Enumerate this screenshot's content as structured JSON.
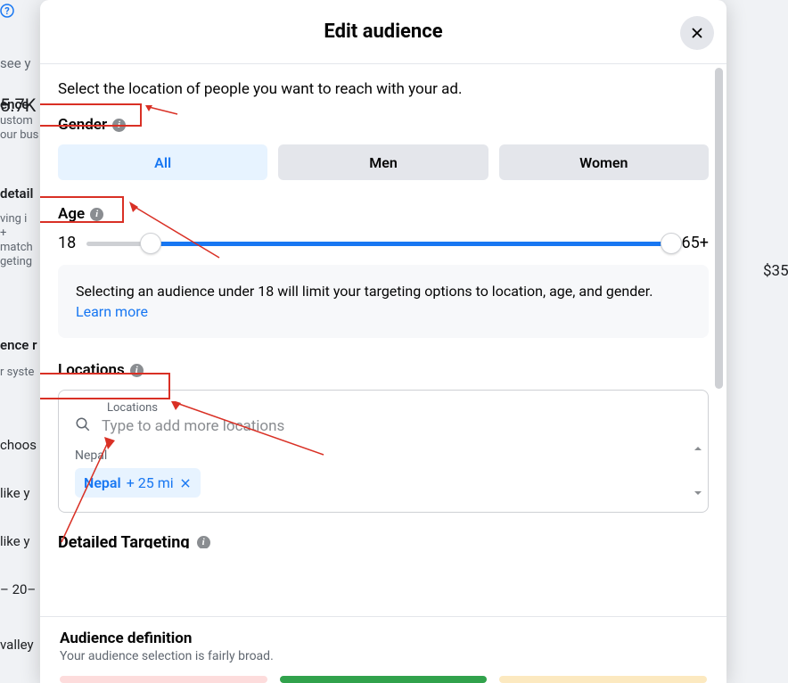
{
  "background": {
    "see": "see y",
    "ence": "ence",
    "custom": "ustom",
    "bus": "our bus",
    "detail": "detail",
    "ving": "ving i",
    "plus": "+",
    "match": "match",
    "geting": "geting",
    "ence_r": "ence r",
    "syst": "r syste",
    "choos": "choos",
    "like1": "like y",
    "like2": "like y",
    "twenty": "– 20–",
    "valley": "valley",
    "reach": "5.7K –",
    "price": "$35"
  },
  "modal": {
    "title": "Edit audience",
    "intro": "Select the location of people you want to reach with your ad.",
    "gender": {
      "label": "Gender",
      "options": [
        "All",
        "Men",
        "Women"
      ],
      "selected_index": 0
    },
    "age": {
      "label": "Age",
      "min": "18",
      "max": "65+",
      "slider_left_pct": 11,
      "slider_right_pct": 100
    },
    "note": {
      "text": "Selecting an audience under 18 will limit your targeting options to location, age, and gender. ",
      "link": "Learn more"
    },
    "locations": {
      "label": "Locations",
      "field_label": "Locations",
      "placeholder": "Type to add more locations",
      "country_label": "Nepal",
      "chip_name": "Nepal",
      "chip_radius": "+ 25 mi"
    },
    "detailed_label": "Detailed Targeting"
  },
  "footer": {
    "title": "Audience definition",
    "subtitle": "Your audience selection is fairly broad.",
    "meter_colors": [
      "#fddcdc",
      "#31a24c",
      "#fce9c0"
    ]
  }
}
